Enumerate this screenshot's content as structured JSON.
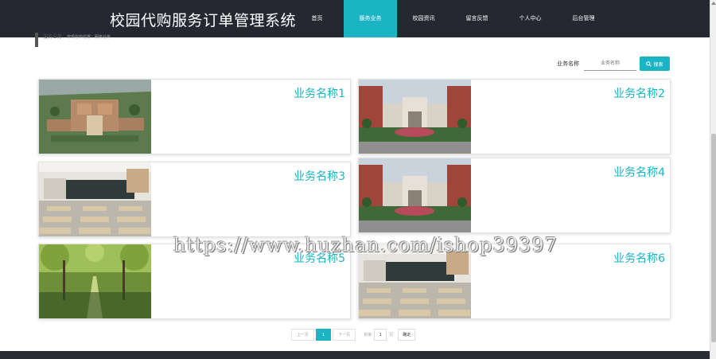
{
  "header": {
    "site_title": "校园代购服务订单管理系统",
    "nav": [
      {
        "label": "首页",
        "active": false
      },
      {
        "label": "服务业务",
        "active": true
      },
      {
        "label": "校园资讯",
        "active": false
      },
      {
        "label": "留言反馈",
        "active": false
      },
      {
        "label": "个人中心",
        "active": false
      },
      {
        "label": "后台管理",
        "active": false
      }
    ]
  },
  "breadcrumb": {
    "title": "服务业务",
    "sub": "您现在的位置：服务业务"
  },
  "search": {
    "label": "业务名称",
    "placeholder": "业务名称",
    "button_label": "搜索"
  },
  "cards": [
    {
      "name": "业务名称1",
      "image": "campus-aerial"
    },
    {
      "name": "业务名称2",
      "image": "school-building"
    },
    {
      "name": "业务名称3",
      "image": "classroom"
    },
    {
      "name": "业务名称4",
      "image": "school-building"
    },
    {
      "name": "业务名称5",
      "image": "tree-avenue"
    },
    {
      "name": "业务名称6",
      "image": "classroom"
    }
  ],
  "pager": {
    "prev": "上一页",
    "current": "1",
    "next": "下一页",
    "goto_label": "到第",
    "page_value": "1",
    "page_unit": "页",
    "confirm": "确定"
  },
  "watermark": "https://www.huzhan.com/ishop39397",
  "colors": {
    "accent": "#1bb4c4",
    "header_bg": "#252831"
  }
}
